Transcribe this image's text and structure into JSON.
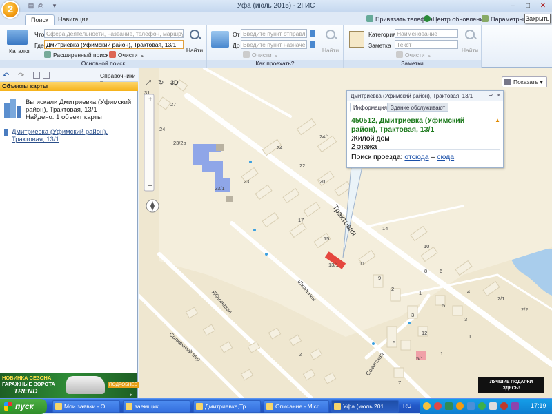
{
  "window": {
    "title": "Уфа (июль 2015) - 2ГИС",
    "logo_text": "2",
    "close_tooltip": "Закрыть"
  },
  "tabs": [
    {
      "label": "Поиск",
      "active": true
    },
    {
      "label": "Навигация",
      "active": false
    }
  ],
  "top_links": {
    "attach_phone": "Привязать телефон",
    "update_center": "Центр обновлений",
    "parameters": "Параметры"
  },
  "ribbon": {
    "basic_search": {
      "catalog_label": "Каталог",
      "what_label": "Что",
      "what_placeholder": "Сфера деятельности, название, телефон, маршрут",
      "where_label": "Где",
      "where_value": "Дмитриевка (Уфимский район), Трактовая, 13/1",
      "find_label": "Найти",
      "advanced_label": "Расширенный поиск",
      "clear_label": "Очистить",
      "caption": "Основной поиск"
    },
    "route": {
      "from_label": "От",
      "from_placeholder": "Введите пункт отправления",
      "to_label": "До",
      "to_placeholder": "Введите пункт назначения",
      "clear_label": "Очистить",
      "find_label": "Найти",
      "caption": "Как проехать?"
    },
    "notes": {
      "category_label": "Категория",
      "category_placeholder": "Наименование",
      "note_label": "Заметка",
      "note_placeholder": "Текст",
      "clear_label": "Очистить",
      "find_label": "Найти",
      "caption": "Заметки"
    }
  },
  "left_panel": {
    "references_label": "Справочники",
    "header": "Объекты карты",
    "search_summary_line1": "Вы искали Дмитриевка (Уфимский",
    "search_summary_line2": "район), Трактовая, 13/1",
    "found_text": "Найдено: 1 объект карты",
    "result_line1": "Дмитриевка (Уфимский район),",
    "result_line2": "Трактовая, 13/1"
  },
  "ad": {
    "line1": "НОВИНКА СЕЗОНА!",
    "line2": "ГАРАЖНЫЕ ВОРОТА",
    "brand": "TREND",
    "more": "ПОДРОБНЕЕ",
    "close": "×"
  },
  "map": {
    "show_button": "Показать",
    "view_3d": "3D",
    "scale_number": "31",
    "street_traktovaya": "Трактовая",
    "street_shkolnaya": "Школьная",
    "street_yablonevaya": "Яблоневая",
    "street_solnechny": "Солнечный пер",
    "street_sovetskaya": "Советская",
    "house_numbers": [
      "27",
      "24",
      "23/2а",
      "23/1",
      "23",
      "24",
      "24/1",
      "22",
      "20",
      "17",
      "15",
      "13/1",
      "14",
      "11",
      "10",
      "9",
      "8",
      "6",
      "4",
      "2/1",
      "2/2",
      "2",
      "1",
      "3",
      "5",
      "3",
      "1",
      "5/1",
      "2",
      "7",
      "9",
      "5",
      "12",
      "1"
    ],
    "ad_text_line1": "ЛУЧШИЕ ПОДАРКИ",
    "ad_text_line2": "ЗДЕСЬ!"
  },
  "popup": {
    "header": "Дмитриевка (Уфимский район), Трактовая, 13/1",
    "tab_info": "Информация",
    "tab_service": "Здание обслуживают",
    "address_line1": "450512, Дмитриевка (Уфимский",
    "address_line2": "район), Трактовая, 13/1",
    "building_type": "Жилой дом",
    "floors": "2 этажа",
    "route_prefix": "Поиск проезда:",
    "route_from": "отсюда",
    "route_dash": "–",
    "route_to": "сюда"
  },
  "taskbar": {
    "start_label": "пуск",
    "tasks": [
      "Мои заявки - О...",
      "заемщик",
      "Дмитриевка,Тр...",
      "Описание - Micr...",
      "Уфа (июль 201..."
    ],
    "lang": "RU",
    "time": "17:19"
  }
}
